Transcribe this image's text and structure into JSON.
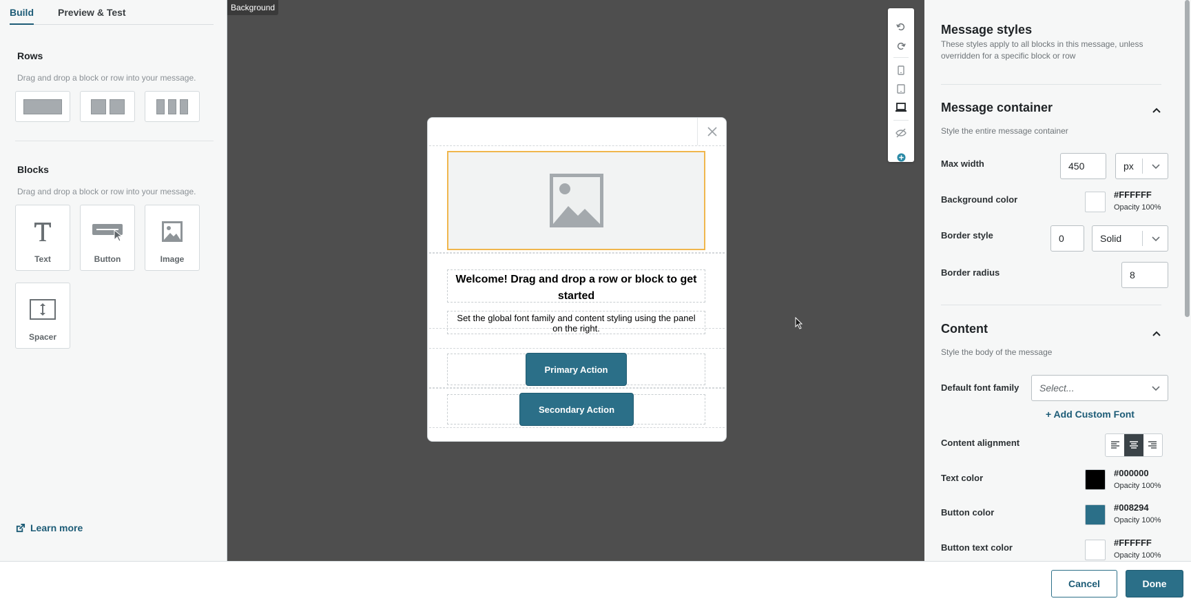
{
  "tabs": {
    "build": "Build",
    "preview": "Preview & Test"
  },
  "rows": {
    "title": "Rows",
    "hint": "Drag and drop a block or row into your message."
  },
  "blocks": {
    "title": "Blocks",
    "hint": "Drag and drop a block or row into your message.",
    "items": [
      {
        "label": "Text",
        "icon": "text-icon"
      },
      {
        "label": "Button",
        "icon": "button-icon"
      },
      {
        "label": "Image",
        "icon": "image-icon"
      },
      {
        "label": "Spacer",
        "icon": "spacer-icon"
      }
    ]
  },
  "learn_more": "Learn more",
  "canvas": {
    "background_tag": "Background",
    "headline": "Welcome! Drag and drop a row or block to get started",
    "body": "Set the global font family and content styling using the panel on the right.",
    "primary_button": "Primary Action",
    "secondary_button": "Secondary Action"
  },
  "panel": {
    "title": "Message styles",
    "hint": "These styles apply to all blocks in this message, unless overridden for a specific block or row",
    "container": {
      "title": "Message container",
      "hint": "Style the entire message container",
      "max_width_label": "Max width",
      "max_width_value": "450",
      "max_width_unit": "px",
      "background_label": "Background color",
      "background_hex": "#FFFFFF",
      "background_opacity": "Opacity 100%",
      "border_style_label": "Border style",
      "border_width": "0",
      "border_style": "Solid",
      "border_radius_label": "Border radius",
      "border_radius": "8"
    },
    "content": {
      "title": "Content",
      "hint": "Style the body of the message",
      "font_family_label": "Default font family",
      "font_family_placeholder": "Select...",
      "add_custom_font": "+ Add Custom Font",
      "alignment_label": "Content alignment",
      "alignment": "center",
      "text_color_label": "Text color",
      "text_color_hex": "#000000",
      "text_color_opacity": "Opacity 100%",
      "button_color_label": "Button color",
      "button_color_hex": "#008294",
      "button_color_opacity": "Opacity 100%",
      "button_text_color_label": "Button text color",
      "button_text_color_hex": "#FFFFFF",
      "button_text_color_opacity": "Opacity 100%"
    }
  },
  "footer": {
    "cancel": "Cancel",
    "done": "Done"
  },
  "colors": {
    "accent": "#2B6F88",
    "canvas": "#4E4E4E",
    "selection": "#F0B64C"
  }
}
